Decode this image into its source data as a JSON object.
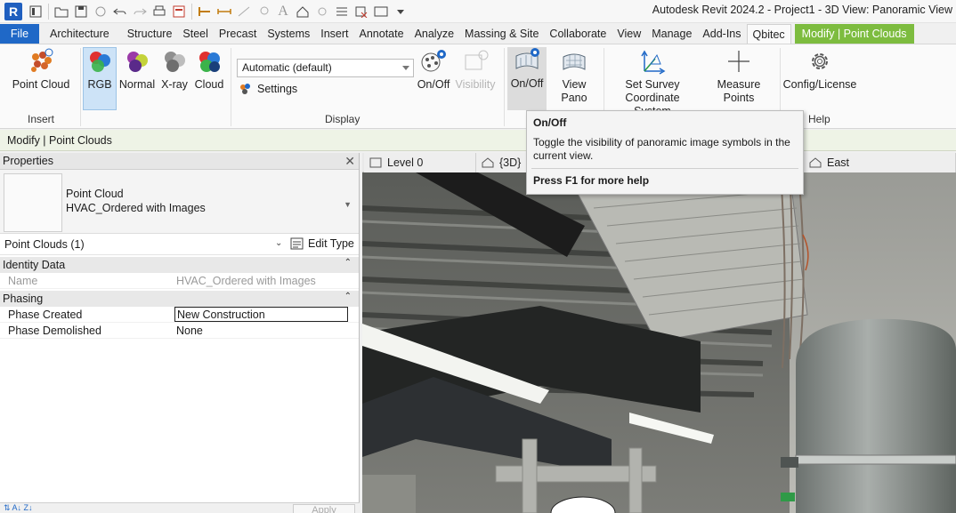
{
  "app": {
    "title": "Autodesk Revit 2024.2 - Project1 - 3D View: Panoramic View"
  },
  "ribbon_tabs": [
    {
      "label": "File"
    },
    {
      "label": "Architecture"
    },
    {
      "label": "Structure"
    },
    {
      "label": "Steel"
    },
    {
      "label": "Precast"
    },
    {
      "label": "Systems"
    },
    {
      "label": "Insert"
    },
    {
      "label": "Annotate"
    },
    {
      "label": "Analyze"
    },
    {
      "label": "Massing & Site"
    },
    {
      "label": "Collaborate"
    },
    {
      "label": "View"
    },
    {
      "label": "Manage"
    },
    {
      "label": "Add-Ins"
    },
    {
      "label": "Qbitec"
    },
    {
      "label": "Modify | Point Clouds"
    }
  ],
  "ribbon": {
    "insert_panel": {
      "title": "Insert",
      "point_cloud": "Point Cloud"
    },
    "display_panel": {
      "title": "Display",
      "rgb": "RGB",
      "normal": "Normal",
      "xray": "X-ray",
      "cloud": "Cloud",
      "display_mode": "Automatic (default)",
      "settings": "Settings",
      "on_off": "On/Off",
      "visibility": "Visibility"
    },
    "pano_panel": {
      "on_off": "On/Off",
      "view_pano": "View Pano",
      "set_survey": "Set Survey",
      "set_survey_2": "Coordinate System",
      "measure_points": "Measure Points"
    },
    "help_panel": {
      "title": "Help",
      "config": "Config/License"
    }
  },
  "options_bar": {
    "label": "Modify | Point Clouds"
  },
  "properties": {
    "header": "Properties",
    "type_name_1": "Point Cloud",
    "type_name_2": "HVAC_Ordered with Images",
    "instance_filter": "Point Clouds (1)",
    "edit_type": "Edit Type",
    "groups": [
      {
        "name": "Identity Data",
        "rows": [
          {
            "key": "Name",
            "value": "HVAC_Ordered with Images"
          }
        ]
      },
      {
        "name": "Phasing",
        "rows": [
          {
            "key": "Phase Created",
            "value": "New Construction"
          },
          {
            "key": "Phase Demolished",
            "value": "None"
          }
        ]
      }
    ],
    "apply": "Apply"
  },
  "view_tabs": [
    {
      "label": "Level 0"
    },
    {
      "label": "{3D}"
    },
    {
      "label": "East"
    }
  ],
  "tooltip": {
    "title": "On/Off",
    "body": "Toggle the visibility of panoramic image symbols in the current view.",
    "help": "Press F1 for more help"
  },
  "colors": {
    "file_tab": "#1f68c7",
    "context_tab": "#7dbc3f",
    "selected_button": "#cde3f7"
  }
}
